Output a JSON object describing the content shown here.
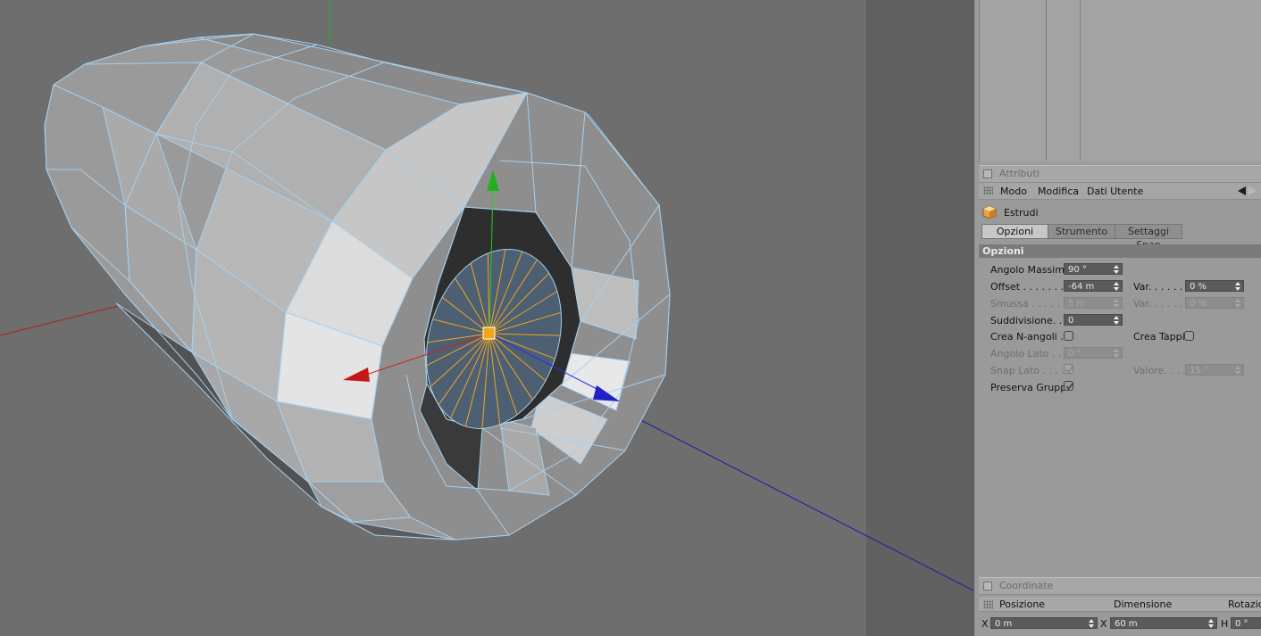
{
  "viewport": {
    "colors": {
      "background": "#6e6e6e",
      "right_strip": "#606060",
      "wire": "#a6d0ee",
      "selected_face": "#4d5f73",
      "spoke": "#f3a51a",
      "axis_x": "#c01616",
      "axis_y": "#16b016",
      "axis_z": "#1616c8"
    }
  },
  "attributes": {
    "section_title": "Attributi",
    "menu": {
      "mode": "Modo",
      "edit": "Modifica",
      "user_data": "Dati Utente"
    },
    "tool": {
      "name": "Estrudi",
      "icon": "extrude-cube-icon"
    },
    "tabs": [
      "Opzioni",
      "Strumento",
      "Settaggi Snap"
    ],
    "group_title": "Opzioni",
    "fields": {
      "max_angle": {
        "label": "Angolo Massimo",
        "value": "90 °"
      },
      "offset": {
        "label": "Offset . . . . . . . .",
        "value": "-64 m"
      },
      "offset_var": {
        "label": "Var. . . . . .",
        "value": "0 %"
      },
      "bevel": {
        "label": "Smussa . . . . . .",
        "value": "5 m"
      },
      "bevel_var": {
        "label": "Var. . . . . .",
        "value": "0 %"
      },
      "subdivision": {
        "label": "Suddivisione. . .",
        "value": "0"
      },
      "create_ngons": {
        "label": "Crea N-angoli . .",
        "checked": false
      },
      "create_caps": {
        "label": "Crea Tappi",
        "checked": false
      },
      "edge_angle": {
        "label": "Angolo Lato . . .",
        "value": "0 °"
      },
      "edge_snap": {
        "label": "Snap Lato . . . .",
        "checked": true
      },
      "edge_snap_value": {
        "label": "Valore. . . .",
        "value": "15 °"
      },
      "preserve_groups": {
        "label": "Preserva Gruppi",
        "checked": true
      }
    }
  },
  "coordinates": {
    "section_title": "Coordinate",
    "headers": {
      "position": "Posizione",
      "size": "Dimensione",
      "rotation": "Rotazion"
    },
    "row": {
      "pos_axis": "X",
      "pos_value": "0 m",
      "size_axis": "X",
      "size_value": "60 m",
      "rot_axis": "H",
      "rot_value": "0 °"
    }
  }
}
